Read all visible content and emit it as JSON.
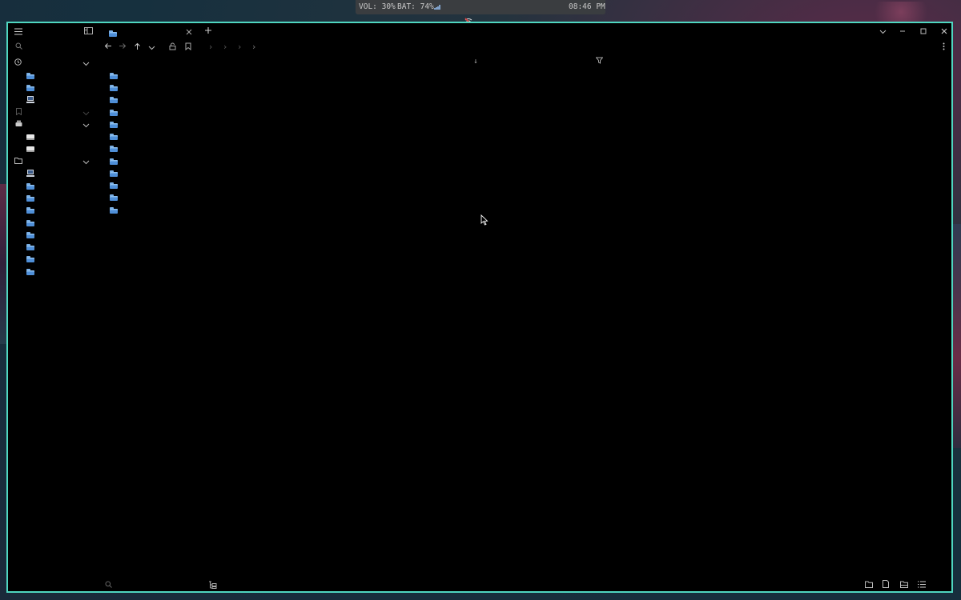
{
  "statusbar": {
    "volume": "VOL: 30%",
    "battery": "BAT: 74%",
    "time": "08:46 PM"
  },
  "icons": {
    "menu": "hamburger-menu-icon",
    "sidebar_toggle": "sidebar-panel-icon",
    "new_tab": "plus-icon",
    "close_tab": "close-icon",
    "back": "arrow-left-icon",
    "forward": "arrow-right-icon",
    "up": "arrow-up-icon",
    "history": "chevron-down-icon",
    "search": "search-icon",
    "filter": "filter-icon",
    "more": "kebab-menu-icon"
  },
  "colors": {
    "window_border": "#4fd6c0",
    "background": "#000000",
    "folder_blue": "#4f8fd8"
  }
}
